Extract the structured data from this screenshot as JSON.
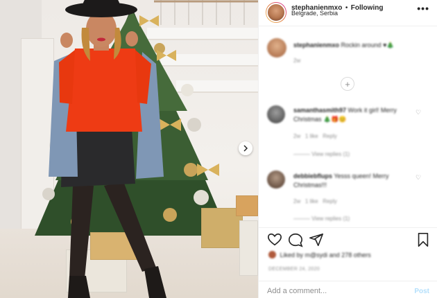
{
  "post": {
    "author": "stephanienmxo",
    "follow_state": "Following",
    "separator": "•",
    "location": "Belgrade, Serbia",
    "more_label": "•••"
  },
  "comments": [
    {
      "username": "stephanienmxo",
      "text": "Rockin around ♥🎄",
      "meta_time": "2w"
    },
    {
      "username": "samanthasmith97",
      "text": "Work it girl! Merry Christmas 🎄🎁😊",
      "meta_time": "2w",
      "meta_likes": "1 like",
      "meta_reply": "Reply",
      "view_replies": "View replies (1)"
    },
    {
      "username": "debbiebflups",
      "text": "Yesss queen! Merry Christmas!!!",
      "meta_time": "2w",
      "meta_likes": "1 like",
      "meta_reply": "Reply",
      "view_replies": "View replies (1)"
    }
  ],
  "likes_text": "Liked by m@sydi and 278 others",
  "timestamp": "DECEMBER 24, 2020",
  "add_comment": {
    "placeholder": "Add a comment...",
    "post_label": "Post"
  },
  "icons": {
    "heart": "heart-icon",
    "comment": "comment-icon",
    "share": "share-icon",
    "save": "bookmark-icon",
    "next": "chevron-right-icon"
  },
  "colors": {
    "accent_blue_disabled": "#b2dffc",
    "text": "#262626",
    "muted": "#8e8e8e",
    "border": "#efefef"
  }
}
